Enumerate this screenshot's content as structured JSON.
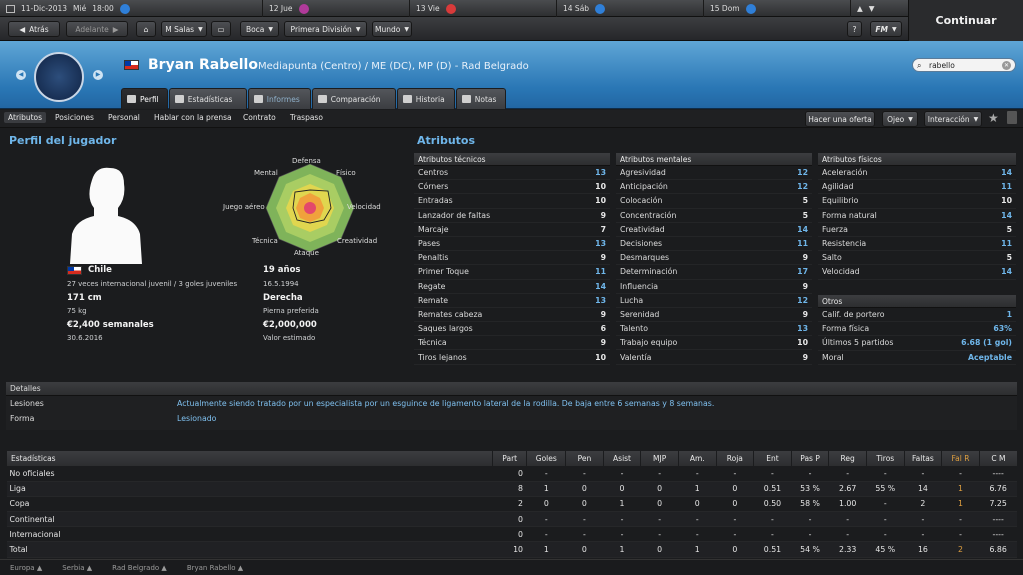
{
  "topbar": {
    "date": "11-Dic-2013",
    "day": "Mié",
    "time": "18:00",
    "days": [
      "12 Jue",
      "13 Vie",
      "14 Sáb",
      "15 Dom"
    ],
    "continue_label": "Continuar"
  },
  "nav": {
    "back": "Atrás",
    "forward": "Adelante",
    "menus": [
      "M Salas",
      "Boca",
      "Primera División",
      "Mundo"
    ],
    "help": "?",
    "fm": "FM"
  },
  "player": {
    "name": "Bryan Rabello",
    "position": "Mediapunta (Centro) / ME (DC), MP (D) - Rad Belgrado",
    "flag": "Chile",
    "search_value": "rabello"
  },
  "tabs": [
    "Perfil",
    "Estadísticas",
    "Informes",
    "Comparación",
    "Historia",
    "Notas"
  ],
  "subnav": [
    "Atributos",
    "Posiciones",
    "Personal",
    "Hablar con la prensa",
    "Contrato",
    "Traspaso"
  ],
  "actions": {
    "offer": "Hacer una oferta",
    "scout": "Ojeo",
    "interaction": "Interacción"
  },
  "profile": {
    "title": "Perfil del jugador",
    "nation": "Chile",
    "caps": "27 veces internacional juvenil / 3 goles juveniles",
    "age": "19 años",
    "dob": "16.5.1994",
    "height": "171 cm",
    "weight": "75 kg",
    "foot": "Derecha",
    "foot_label": "Pierna preferida",
    "wage": "€2,400 semanales",
    "contract": "30.6.2016",
    "value": "€2,000,000",
    "value_label": "Valor estimado",
    "radar_labels": [
      "Defensa",
      "Físico",
      "Velocidad",
      "Creatividad",
      "Ataque",
      "Técnica",
      "Juego aéreo",
      "Mental"
    ]
  },
  "attributes": {
    "title": "Atributos",
    "technical_title": "Atributos técnicos",
    "technical": [
      [
        "Centros",
        "13"
      ],
      [
        "Córners",
        "10"
      ],
      [
        "Entradas",
        "10"
      ],
      [
        "Lanzador de faltas",
        "9"
      ],
      [
        "Marcaje",
        "7"
      ],
      [
        "Pases",
        "13"
      ],
      [
        "Penaltis",
        "9"
      ],
      [
        "Primer Toque",
        "11"
      ],
      [
        "Regate",
        "14"
      ],
      [
        "Remate",
        "13"
      ],
      [
        "Remates cabeza",
        "9"
      ],
      [
        "Saques largos",
        "6"
      ],
      [
        "Técnica",
        "9"
      ],
      [
        "Tiros lejanos",
        "10"
      ]
    ],
    "mental_title": "Atributos mentales",
    "mental": [
      [
        "Agresividad",
        "12"
      ],
      [
        "Anticipación",
        "12"
      ],
      [
        "Colocación",
        "5"
      ],
      [
        "Concentración",
        "5"
      ],
      [
        "Creatividad",
        "14"
      ],
      [
        "Decisiones",
        "11"
      ],
      [
        "Desmarques",
        "9"
      ],
      [
        "Determinación",
        "17"
      ],
      [
        "Influencia",
        "9"
      ],
      [
        "Lucha",
        "12"
      ],
      [
        "Serenidad",
        "9"
      ],
      [
        "Talento",
        "13"
      ],
      [
        "Trabajo equipo",
        "10"
      ],
      [
        "Valentía",
        "9"
      ]
    ],
    "physical_title": "Atributos físicos",
    "physical": [
      [
        "Aceleración",
        "14"
      ],
      [
        "Agilidad",
        "11"
      ],
      [
        "Equilibrio",
        "10"
      ],
      [
        "Forma natural",
        "14"
      ],
      [
        "Fuerza",
        "5"
      ],
      [
        "Resistencia",
        "11"
      ],
      [
        "Salto",
        "5"
      ],
      [
        "Velocidad",
        "14"
      ]
    ],
    "other_title": "Otros",
    "other": [
      [
        "Calif. de portero",
        "1"
      ],
      [
        "Forma física",
        "63%"
      ],
      [
        "Últimos 5 partidos",
        "6.68 (1 gol)"
      ],
      [
        "Moral",
        "Aceptable"
      ]
    ]
  },
  "details": {
    "title": "Detalles",
    "injury_label": "Lesiones",
    "injury": "Actualmente siendo tratado por un especialista por un esguince de ligamento lateral de la rodilla. De baja entre 6 semanas y 8 semanas.",
    "form_label": "Forma",
    "form": "Lesionado"
  },
  "stats": {
    "headers": [
      "Estadísticas",
      "Part",
      "Goles",
      "Pen",
      "Asist",
      "MJP",
      "Am.",
      "Roja",
      "Ent",
      "Pas P",
      "Reg",
      "Tiros",
      "Faltas",
      "Fal R",
      "C M"
    ],
    "rows": [
      [
        "No oficiales",
        "0",
        "-",
        "-",
        "-",
        "-",
        "-",
        "-",
        "-",
        "-",
        "-",
        "-",
        "-",
        "-",
        "----"
      ],
      [
        "Liga",
        "8",
        "1",
        "0",
        "0",
        "0",
        "1",
        "0",
        "0.51",
        "53 %",
        "2.67",
        "55 %",
        "14",
        "1",
        "6.76"
      ],
      [
        "Copa",
        "2",
        "0",
        "0",
        "1",
        "0",
        "0",
        "0",
        "0.50",
        "58 %",
        "1.00",
        "-",
        "2",
        "1",
        "7.25"
      ],
      [
        "Continental",
        "0",
        "-",
        "-",
        "-",
        "-",
        "-",
        "-",
        "-",
        "-",
        "-",
        "-",
        "-",
        "-",
        "----"
      ],
      [
        "Internacional",
        "0",
        "-",
        "-",
        "-",
        "-",
        "-",
        "-",
        "-",
        "-",
        "-",
        "-",
        "-",
        "-",
        "----"
      ],
      [
        "Total",
        "10",
        "1",
        "0",
        "1",
        "0",
        "1",
        "0",
        "0.51",
        "54 %",
        "2.33",
        "45 %",
        "16",
        "2",
        "6.86"
      ]
    ]
  },
  "breadcrumbs": [
    "Europa",
    "Serbia",
    "Rad Belgrado",
    "Bryan Rabello"
  ],
  "colors": {
    "accent": "#6fb6ea",
    "header": "#2a77b5"
  }
}
